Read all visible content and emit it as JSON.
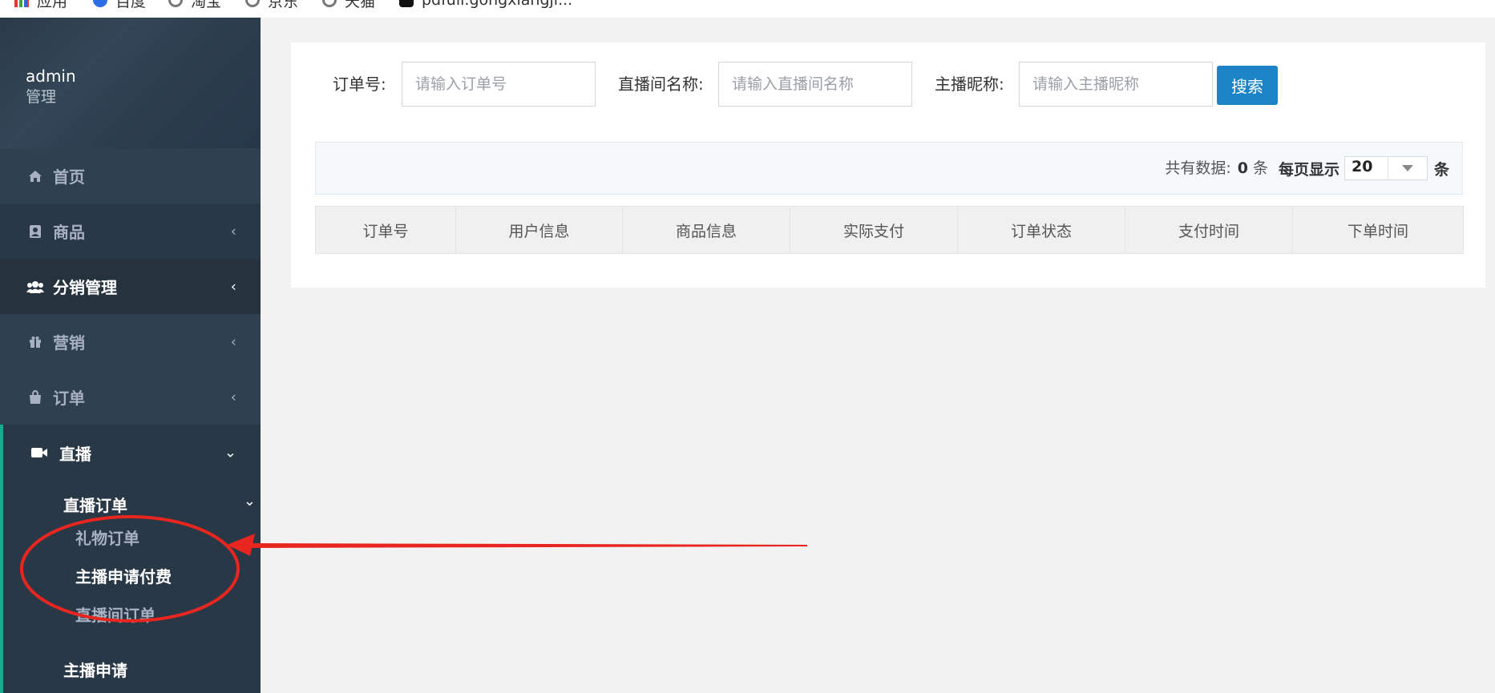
{
  "bookmarks": [
    {
      "label": "应用",
      "icon": "apps-grid-icon"
    },
    {
      "label": "百度",
      "icon": "baidu-paw-icon"
    },
    {
      "label": "淘宝",
      "icon": "globe-icon"
    },
    {
      "label": "京东",
      "icon": "globe-icon"
    },
    {
      "label": "天猫",
      "icon": "globe-icon"
    },
    {
      "label": "pdfull.gongxiangji...",
      "icon": "tiktok-icon"
    }
  ],
  "sidebar": {
    "profile": {
      "name": "admin",
      "role": "管理"
    },
    "items": [
      {
        "label": "首页",
        "icon": "home-icon"
      },
      {
        "label": "商品",
        "icon": "contact-card-icon"
      },
      {
        "label": "分销管理",
        "icon": "users-icon"
      },
      {
        "label": "营销",
        "icon": "gift-icon"
      },
      {
        "label": "订单",
        "icon": "shopping-bag-icon"
      }
    ],
    "live": {
      "label": "直播",
      "icon": "video-camera-icon",
      "sub_head": "直播订单",
      "leaves": [
        "礼物订单",
        "主播申请付费",
        "直播间订单"
      ],
      "next": "主播申请"
    }
  },
  "search": {
    "order_no_label": "订单号:",
    "order_no_placeholder": "请输入订单号",
    "room_label": "直播间名称:",
    "room_placeholder": "请输入直播间名称",
    "anchor_label": "主播昵称:",
    "anchor_placeholder": "请输入主播昵称",
    "button": "搜索"
  },
  "info": {
    "total_label": "共有数据:",
    "total_count": "0",
    "total_unit": "条",
    "per_page_label": "每页显示",
    "per_page_value": "20",
    "per_page_unit": "条"
  },
  "table": {
    "columns": [
      "订单号",
      "用户信息",
      "商品信息",
      "实际支付",
      "订单状态",
      "支付时间",
      "下单时间"
    ]
  },
  "colors": {
    "sidebar_bg": "#2f4050",
    "accent_green": "#19aa8d",
    "button_blue": "#1c84c6",
    "annotation_red": "#e8261f"
  }
}
